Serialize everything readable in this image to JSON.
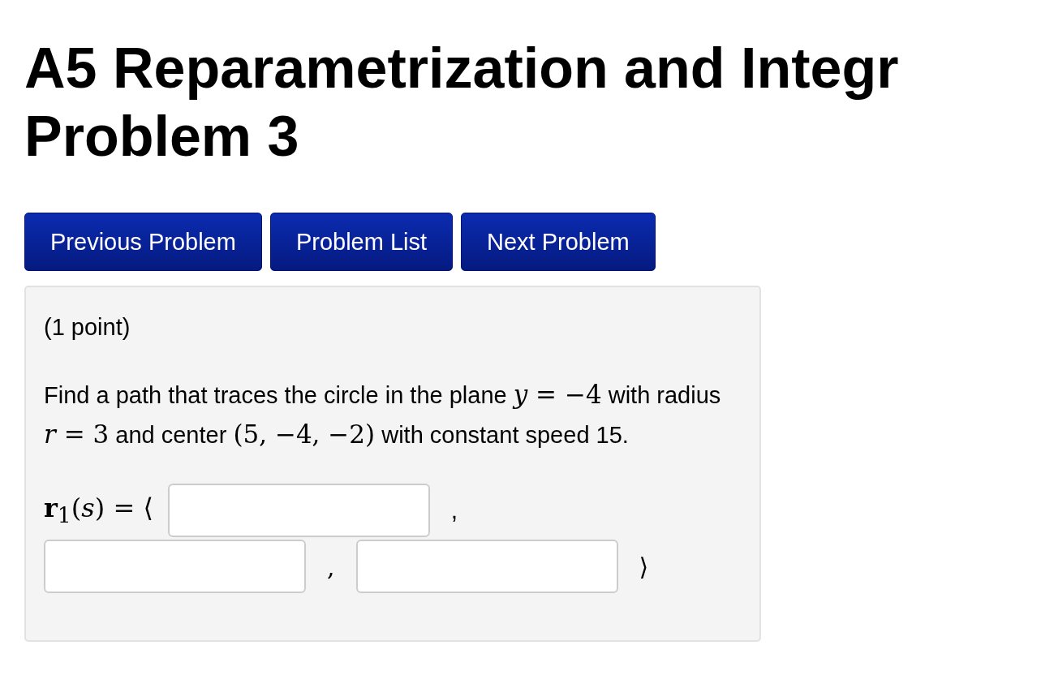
{
  "title_lines": [
    "A5 Reparametrization and Integr",
    "Problem 3"
  ],
  "nav_buttons": [
    "Previous Problem",
    "Problem List",
    "Next Problem"
  ],
  "problem": {
    "points": "(1 point)",
    "statement": [
      {
        "kind": "text",
        "text": "Find a path that traces the circle in the plane "
      },
      {
        "kind": "math",
        "text": "*y* = −4"
      },
      {
        "kind": "text",
        "text": " with radius "
      },
      {
        "kind": "math",
        "text": "*r* = 3"
      },
      {
        "kind": "text",
        "text": " and center "
      },
      {
        "kind": "math",
        "text": "(5, −4, −2)"
      },
      {
        "kind": "text",
        "text": " with constant speed 15."
      }
    ],
    "answer": {
      "label": "**r**$_{1}$(*s*) = ⟨",
      "separators": [
        ",",
        ",",
        "⟩"
      ]
    }
  }
}
